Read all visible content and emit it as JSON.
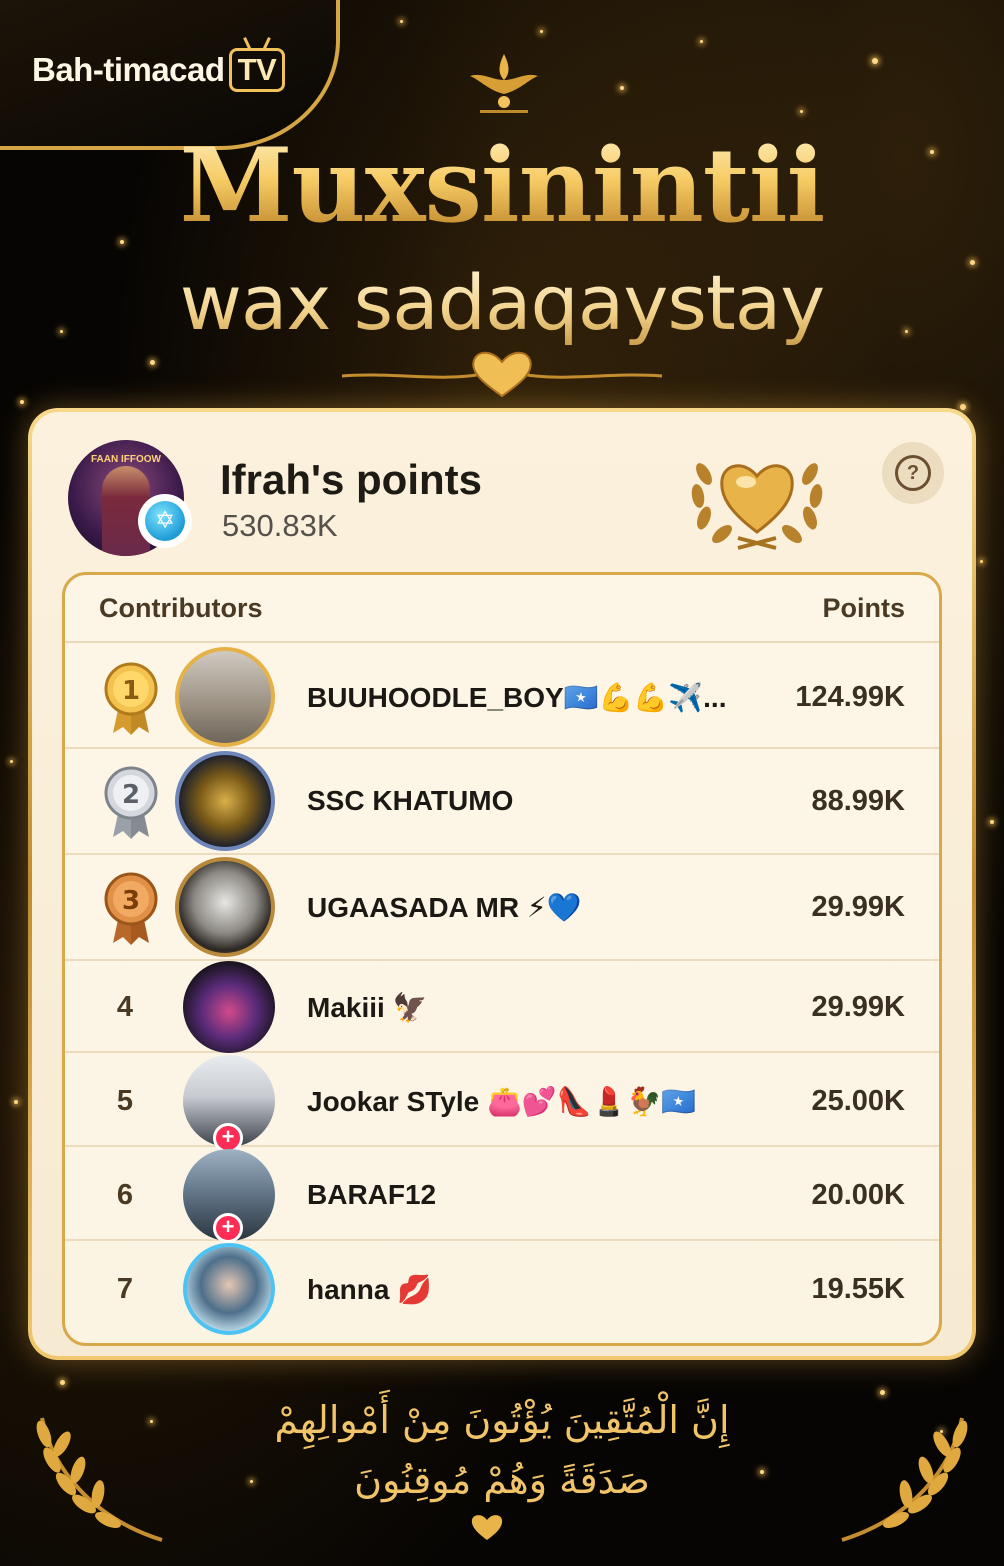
{
  "brand": {
    "name": "Bah-timacad",
    "tv": "TV"
  },
  "headline": {
    "title": "Muxsinintii",
    "subtitle": "wax sadaqaystay"
  },
  "owner": {
    "title": "Ifrah's points",
    "points": "530.83K"
  },
  "table": {
    "contributors_header": "Contributors",
    "points_header": "Points",
    "rows": [
      {
        "rank": "1",
        "name": "BUUHOODLE_BOY🇸🇴💪💪✈️...",
        "points": "124.99K",
        "medal": "gold"
      },
      {
        "rank": "2",
        "name": "SSC KHATUMO",
        "points": "88.99K",
        "medal": "silver"
      },
      {
        "rank": "3",
        "name": "UGAASADA MR ⚡💙",
        "points": "29.99K",
        "medal": "bronze"
      },
      {
        "rank": "4",
        "name": "Makiii 🦅",
        "points": "29.99K"
      },
      {
        "rank": "5",
        "name": "Jookar STyle 👛💕👠💄🐓🇸🇴",
        "points": "25.00K"
      },
      {
        "rank": "6",
        "name": "BARAF12",
        "points": "20.00K"
      },
      {
        "rank": "7",
        "name": "hanna 💋",
        "points": "19.55K"
      }
    ]
  },
  "footer": {
    "verse_line1": "إِنَّ الْمُتَّقِينَ يُؤْتُونَ مِنْ أَمْوالِهِمْ",
    "verse_line2": "صَدَقَةً وَهُمْ مُوقِنُونَ"
  },
  "colors": {
    "gold": "#f3c560",
    "card": "#fbf1dd",
    "plus": "#ff2d55"
  },
  "icons": [
    "tv-icon",
    "crown-ornament-icon",
    "heart-ornament-icon",
    "verified-star-icon",
    "laurel-heart-trophy-icon",
    "help-icon",
    "medal-1-icon",
    "medal-2-icon",
    "medal-3-icon",
    "follow-plus-icon",
    "laurel-icon",
    "heart-icon"
  ]
}
